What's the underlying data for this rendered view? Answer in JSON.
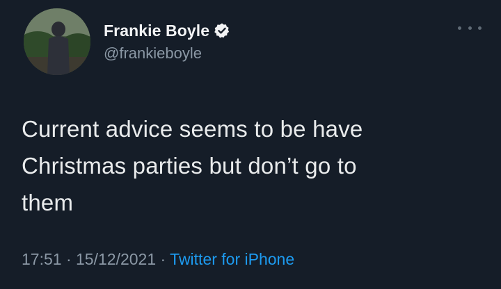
{
  "author": {
    "display_name": "Frankie Boyle",
    "handle": "@frankieboyle",
    "verified": true
  },
  "tweet": {
    "text_lines": [
      "Current advice seems to be have",
      "Christmas parties but don’t go to",
      "them"
    ]
  },
  "meta": {
    "time": "17:51",
    "separator": "·",
    "date": "15/12/2021",
    "source": "Twitter for iPhone"
  },
  "icons": {
    "verified": "verified-badge-icon",
    "more": "more-options-icon"
  },
  "colors": {
    "background": "#151d28",
    "link": "#1d9bf0",
    "secondary_text": "#8b98a5"
  }
}
